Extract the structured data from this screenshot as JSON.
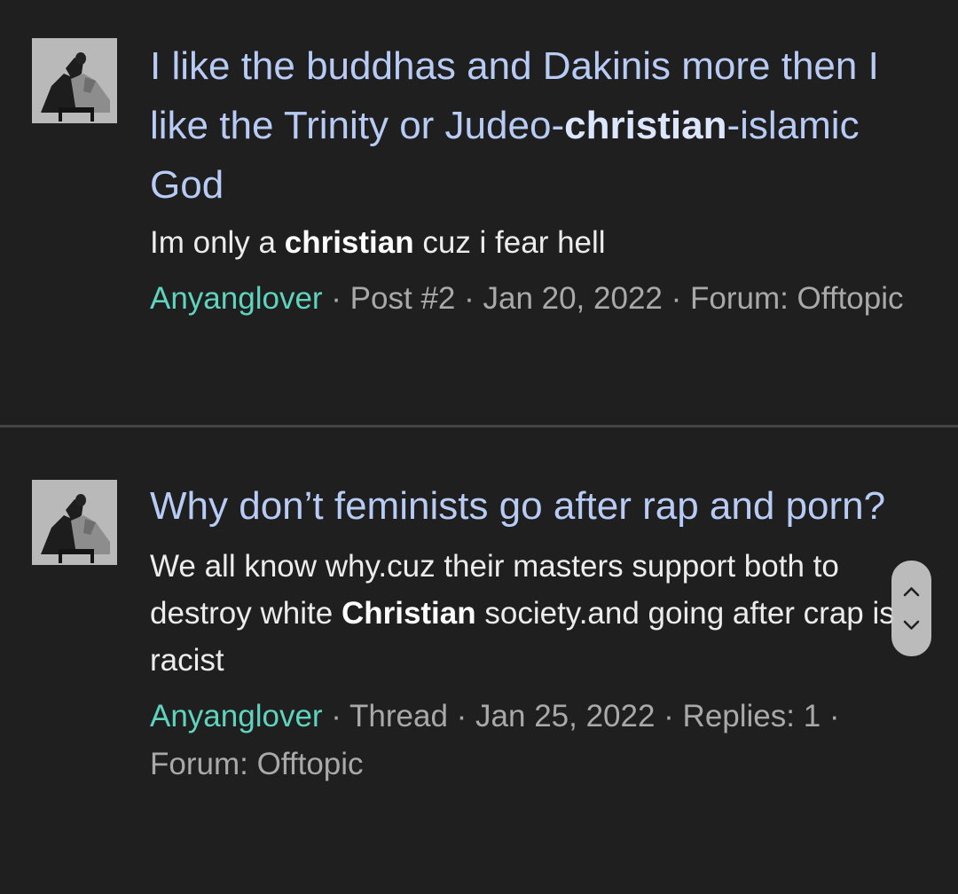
{
  "results": [
    {
      "title_parts": [
        {
          "text": "I like the buddhas and Dakinis more then I like the Trinity or Judeo-",
          "bold": false
        },
        {
          "text": "christian",
          "bold": true
        },
        {
          "text": "-islamic God",
          "bold": false
        }
      ],
      "snippet_parts": [
        {
          "text": "Im only a ",
          "bold": false
        },
        {
          "text": "christian",
          "bold": true
        },
        {
          "text": " cuz i fear hell",
          "bold": false
        }
      ],
      "author": "Anyanglover",
      "meta": " · Post #2 · Jan 20, 2022 · Forum: Offtopic"
    },
    {
      "title_parts": [
        {
          "text": "Why don’t feminists go after rap and porn?",
          "bold": false
        }
      ],
      "snippet_parts": [
        {
          "text": "We all know why.cuz their masters support both to destroy white ",
          "bold": false
        },
        {
          "text": "Christian",
          "bold": true
        },
        {
          "text": " society.and going after crap is racist",
          "bold": false
        }
      ],
      "author": "Anyanglover",
      "meta": " · Thread · Jan 25, 2022 · Replies: 1 · Forum: Offtopic"
    }
  ],
  "icons": {
    "avatar": "user-avatar-icon",
    "scroll_up": "chevron-up-icon",
    "scroll_down": "chevron-down-icon"
  },
  "colors": {
    "background": "#1f1f1f",
    "title_link": "#b7cbf5",
    "author_link": "#5fd3be",
    "meta_text": "#a9a9a9",
    "divider": "#444444"
  }
}
